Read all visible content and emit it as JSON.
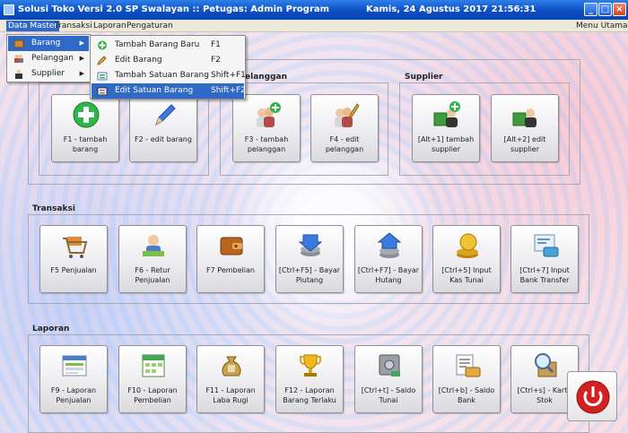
{
  "window": {
    "title_left": "Solusi Toko Versi 2.0 SP Swalayan   ::  Petugas: Admin Program",
    "title_right": "Kamis, 24 Agustus 2017    21:56:31",
    "minimize_glyph": "_",
    "maximize_glyph": "□",
    "close_glyph": "×"
  },
  "menubar": {
    "items": [
      "Data Master",
      "Transaksi",
      "Laporan",
      "Pengaturan"
    ],
    "right": "Menu Utama"
  },
  "data_master_menu": [
    {
      "label": "Barang",
      "icon": "box-icon"
    },
    {
      "label": "Pelanggan",
      "icon": "customers-icon"
    },
    {
      "label": "Supplier",
      "icon": "supplier-icon"
    }
  ],
  "barang_submenu": [
    {
      "label": "Tambah Barang Baru",
      "shortcut": "F1",
      "icon": "add-icon"
    },
    {
      "label": "Edit Barang",
      "shortcut": "F2",
      "icon": "pencil-icon"
    },
    {
      "label": "Tambah Satuan Barang",
      "shortcut": "Shift+F1",
      "icon": "add-unit-icon"
    },
    {
      "label": "Edit Satuan Barang",
      "shortcut": "Shift+F2",
      "icon": "edit-unit-icon"
    }
  ],
  "sections": {
    "pelanggan_fragment": "elanggan",
    "supplier": "Supplier",
    "transaksi": "Transaksi",
    "laporan": "Laporan"
  },
  "data_master_tiles": [
    {
      "label": "F1 - tambah barang",
      "icon": "plus-icon"
    },
    {
      "label": "F2 - edit barang",
      "icon": "pencil-icon"
    },
    {
      "label": "F3 - tambah pelanggan",
      "icon": "add-customer-icon"
    },
    {
      "label": "F4 - edit pelanggan",
      "icon": "edit-customer-icon"
    },
    {
      "label": "[Alt+1] tambah supplier",
      "icon": "add-supplier-icon"
    },
    {
      "label": "[Alt+2] edit supplier",
      "icon": "edit-supplier-icon"
    }
  ],
  "transaksi_tiles": [
    {
      "label": "F5 Penjualan",
      "icon": "cart-icon"
    },
    {
      "label": "F6 - Retur Penjualan",
      "icon": "return-sales-icon"
    },
    {
      "label": "F7 Pembelian",
      "icon": "wallet-icon"
    },
    {
      "label": "[Ctrl+F5] - Bayar Piutang",
      "icon": "receivable-icon"
    },
    {
      "label": "[Ctrl+F7] - Bayar Hutang",
      "icon": "debt-icon"
    },
    {
      "label": "[Ctrl+5] Input Kas Tunai",
      "icon": "coins-icon"
    },
    {
      "label": "[Ctrl+7] Input Bank Transfer",
      "icon": "bank-transfer-icon"
    }
  ],
  "laporan_tiles": [
    {
      "label": "F9 - Laporan Penjualan",
      "icon": "sales-report-icon"
    },
    {
      "label": "F10 - Laporan Pembelian",
      "icon": "purchase-report-icon"
    },
    {
      "label": "F11 - Laporan Laba Rugi",
      "icon": "money-bag-icon"
    },
    {
      "label": "F12 - Laporan Barang Terlaku",
      "icon": "trophy-icon"
    },
    {
      "label": "[Ctrl+t] - Saldo Tunai",
      "icon": "safe-icon"
    },
    {
      "label": "[Ctrl+b] - Saldo Bank",
      "icon": "bank-balance-icon"
    },
    {
      "label": "[Ctrl+s] - Kartu Stok",
      "icon": "stock-card-icon"
    }
  ],
  "power_icon": "power-icon"
}
